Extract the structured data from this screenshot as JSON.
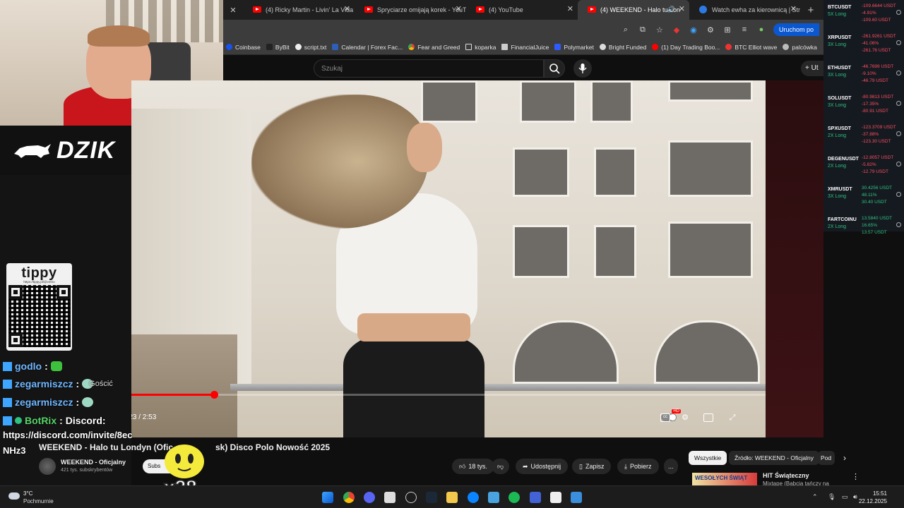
{
  "browser": {
    "tabs": [
      {
        "title": "(4) Ricky Martin - Livin' La Vida",
        "active": false
      },
      {
        "title": "Spryciarze omijają korek - YouT",
        "active": false
      },
      {
        "title": "(4) YouTube",
        "active": false
      },
      {
        "title": "(4) WEEKEND - Halo tu Lon",
        "active": true
      },
      {
        "title": "Watch ewha za kierownicą | Str",
        "active": false
      }
    ],
    "new_tab": "+",
    "run_button": "Uruchom po",
    "bookmarks": [
      "Coinbase",
      "ByBit",
      "script.txt",
      "Calendar | Forex Fac...",
      "Fear and Greed",
      "koparka",
      "FinancialJuice",
      "Polymarket",
      "Bright Funded",
      "(1) Day Trading Boo...",
      "BTC Elliot wave",
      "palcówka"
    ]
  },
  "youtube": {
    "search_placeholder": "Szukaj",
    "create_label": "+ Ut",
    "video": {
      "time": "0:23 / 2:53",
      "progress": 0.13,
      "hd_badge": "HD",
      "title": "WEEKEND - Halo tu Londyn (Ofic",
      "title_tail": "sk) Disco Polo Nowość 2025"
    },
    "channel": {
      "name": "WEEKEND - Oficjalny",
      "subs": "421 tys. subskrybentów",
      "subscribe": "Subs"
    },
    "actions": {
      "likes": "18 tys.",
      "share": "Udostępnij",
      "save": "Zapisz",
      "download": "Pobierz",
      "more": "..."
    },
    "chips": [
      "Wszystkie",
      "Źródło: WEEKEND - Oficjalny",
      "Pod"
    ],
    "recommendation": {
      "thumb_text": "WESOŁYCH ŚWIĄT",
      "title": "HIT Świąteczny",
      "subtitle": "Mixtape (Babcia tańczy na"
    }
  },
  "stream": {
    "brand": "DZIK",
    "tippy": {
      "title": "tippy",
      "url": "https://tippy.pl/@zetiro"
    },
    "chat": [
      {
        "user": "godlo",
        "sep": ":"
      },
      {
        "user": "zegarmiszcz",
        "sep": ":"
      },
      {
        "user": "zegarmiszcz",
        "sep": ":"
      },
      {
        "user": "BotRix",
        "sep": ":",
        "text": "Discord:"
      }
    ],
    "chat_overlap_text": "Gościć",
    "discord_link": "https://discord.com/invite/8ec",
    "discord_link2": "NHz3",
    "emote_count": "x28"
  },
  "crypto": [
    {
      "symbol": "BTCUSDT",
      "position": "5X Long",
      "values": [
        "-109.6644 USDT",
        "-4.91%",
        "-109.60 USDT"
      ],
      "trend": "neg"
    },
    {
      "symbol": "XRPUSDT",
      "position": "3X Long",
      "values": [
        "-261.9261 USDT",
        "-41.06%",
        "-261.76 USDT"
      ],
      "trend": "neg"
    },
    {
      "symbol": "ETHUSDT",
      "position": "3X Long",
      "values": [
        "-46.7699 USDT",
        "-9.10%",
        "-46.79 USDT"
      ],
      "trend": "neg"
    },
    {
      "symbol": "SOLUSDT",
      "position": "3X Long",
      "values": [
        "-80.9813 USDT",
        "-17.35%",
        "-80.91 USDT"
      ],
      "trend": "neg"
    },
    {
      "symbol": "SPXUSDT",
      "position": "2X Long",
      "values": [
        "-123.3709 USDT",
        "-37.88%",
        "-123.30 USDT"
      ],
      "trend": "neg"
    },
    {
      "symbol": "DEGENUSDT",
      "position": "2X Long",
      "values": [
        "-12.8057 USDT",
        "-5.82%",
        "-12.79 USDT"
      ],
      "trend": "neg"
    },
    {
      "symbol": "XMRUSDT",
      "position": "3X Long",
      "values": [
        "30.4256 USDT",
        "48.11%",
        "30.40 USDT"
      ],
      "trend": "pos"
    },
    {
      "symbol": "FARTCOINU",
      "position": "2X Long",
      "values": [
        "13.5840 USDT",
        "16.65%",
        "13.57 USDT"
      ],
      "trend": "pos"
    }
  ],
  "taskbar": {
    "weather_temp": "3°C",
    "weather_desc": "Pochmurnie",
    "time": "15:51",
    "date": "22.12.2025"
  },
  "colors": {
    "accent": "#ff0000",
    "chat_user": "#6fb7ff",
    "negative": "#ff4d5e",
    "positive": "#2ec27e"
  }
}
